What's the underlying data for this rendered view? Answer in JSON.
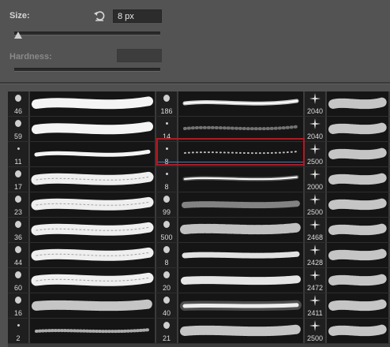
{
  "controls": {
    "size_label": "Size:",
    "size_value": "8 px",
    "hardness_label": "Hardness:",
    "reset_icon": "reset-size-icon",
    "size_slider_level": 0.02
  },
  "brushes": {
    "columns": [
      {
        "items": [
          {
            "size": "46",
            "style": "hard"
          },
          {
            "size": "59",
            "style": "hard"
          },
          {
            "size": "11",
            "style": "hard-thin"
          },
          {
            "size": "17",
            "style": "rough"
          },
          {
            "size": "23",
            "style": "rough"
          },
          {
            "size": "36",
            "style": "rough"
          },
          {
            "size": "44",
            "style": "rough"
          },
          {
            "size": "60",
            "style": "rough"
          },
          {
            "size": "16",
            "style": "bristle"
          },
          {
            "size": "2",
            "style": "spray"
          }
        ]
      },
      {
        "items": [
          {
            "size": "186",
            "style": "soft"
          },
          {
            "size": "14",
            "style": "speckle"
          },
          {
            "size": "8",
            "style": "dots",
            "selected": true
          },
          {
            "size": "8",
            "style": "soft-thin"
          },
          {
            "size": "99",
            "style": "grass"
          },
          {
            "size": "500",
            "style": "cloud"
          },
          {
            "size": "8",
            "style": "chalk"
          },
          {
            "size": "20",
            "style": "chalk-heavy"
          },
          {
            "size": "40",
            "style": "glow"
          },
          {
            "size": "21",
            "style": "bristle"
          }
        ]
      },
      {
        "items": [
          {
            "size": "2040",
            "style": "fan"
          },
          {
            "size": "2040",
            "style": "fan"
          },
          {
            "size": "2500",
            "style": "star"
          },
          {
            "size": "2000",
            "style": "star"
          },
          {
            "size": "2500",
            "style": "star"
          },
          {
            "size": "2468",
            "style": "star"
          },
          {
            "size": "2428",
            "style": "star"
          },
          {
            "size": "2472",
            "style": "star"
          },
          {
            "size": "2411",
            "style": "star"
          },
          {
            "size": "2500",
            "style": "star"
          }
        ]
      }
    ]
  }
}
